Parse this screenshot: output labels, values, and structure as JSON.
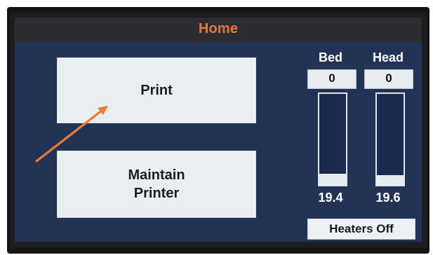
{
  "screen": {
    "title": "Home",
    "colors": {
      "background": "#233356",
      "titlebar": "#2c2d31",
      "title_text": "#e8773f",
      "button_bg": "#e9eff0",
      "annotation_arrow": "#ee7a3a"
    }
  },
  "actions": {
    "print_label": "Print",
    "maintain_label": "Maintain\nPrinter"
  },
  "temperatures": {
    "bed": {
      "label": "Bed",
      "setpoint": "0",
      "current": "19.4",
      "fill_fraction": 0.12
    },
    "head": {
      "label": "Head",
      "setpoint": "0",
      "current": "19.6",
      "fill_fraction": 0.11
    }
  },
  "heaters": {
    "status_label": "Heaters Off"
  },
  "annotation": {
    "icon": "orange-arrow-icon",
    "points_to": "print-button"
  }
}
